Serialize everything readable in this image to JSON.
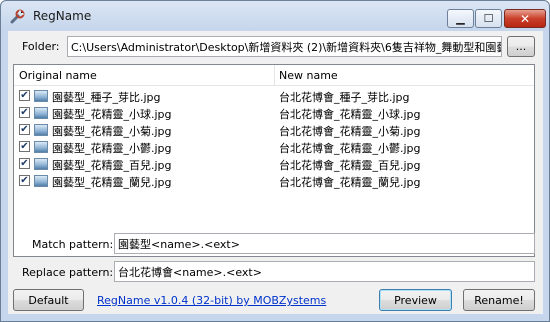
{
  "window": {
    "title": "RegName"
  },
  "titlebar": {
    "minimize_glyph": "▁",
    "maximize_glyph": "☐",
    "close_glyph": "✕"
  },
  "folder": {
    "label": "Folder:",
    "path": "C:\\Users\\Administrator\\Desktop\\新增資料夾 (2)\\新增資料夾\\6隻吉祥物_舞動型和園藝",
    "browse_label": "..."
  },
  "list": {
    "columns": {
      "original": "Original name",
      "new": "New name"
    },
    "rows": [
      {
        "checked": true,
        "original": "園藝型_種子_芽比.jpg",
        "new": "台北花博會_種子_芽比.jpg"
      },
      {
        "checked": true,
        "original": "園藝型_花精靈_小球.jpg",
        "new": "台北花博會_花精靈_小球.jpg"
      },
      {
        "checked": true,
        "original": "園藝型_花精靈_小菊.jpg",
        "new": "台北花博會_花精靈_小菊.jpg"
      },
      {
        "checked": true,
        "original": "園藝型_花精靈_小鬱.jpg",
        "new": "台北花博會_花精靈_小鬱.jpg"
      },
      {
        "checked": true,
        "original": "園藝型_花精靈_百兒.jpg",
        "new": "台北花博會_花精靈_百兒.jpg"
      },
      {
        "checked": true,
        "original": "園藝型_花精靈_蘭兒.jpg",
        "new": "台北花博會_花精靈_蘭兒.jpg"
      }
    ]
  },
  "match": {
    "label": "Match pattern:",
    "value": "園藝型<name>.<ext>"
  },
  "replace": {
    "label": "Replace pattern:",
    "value": "台北花博會<name>.<ext>"
  },
  "footer": {
    "default_label": "Default",
    "about_link": "RegName v1.0.4 (32-bit) by MOBZystems",
    "preview_label": "Preview",
    "rename_label": "Rename!"
  }
}
